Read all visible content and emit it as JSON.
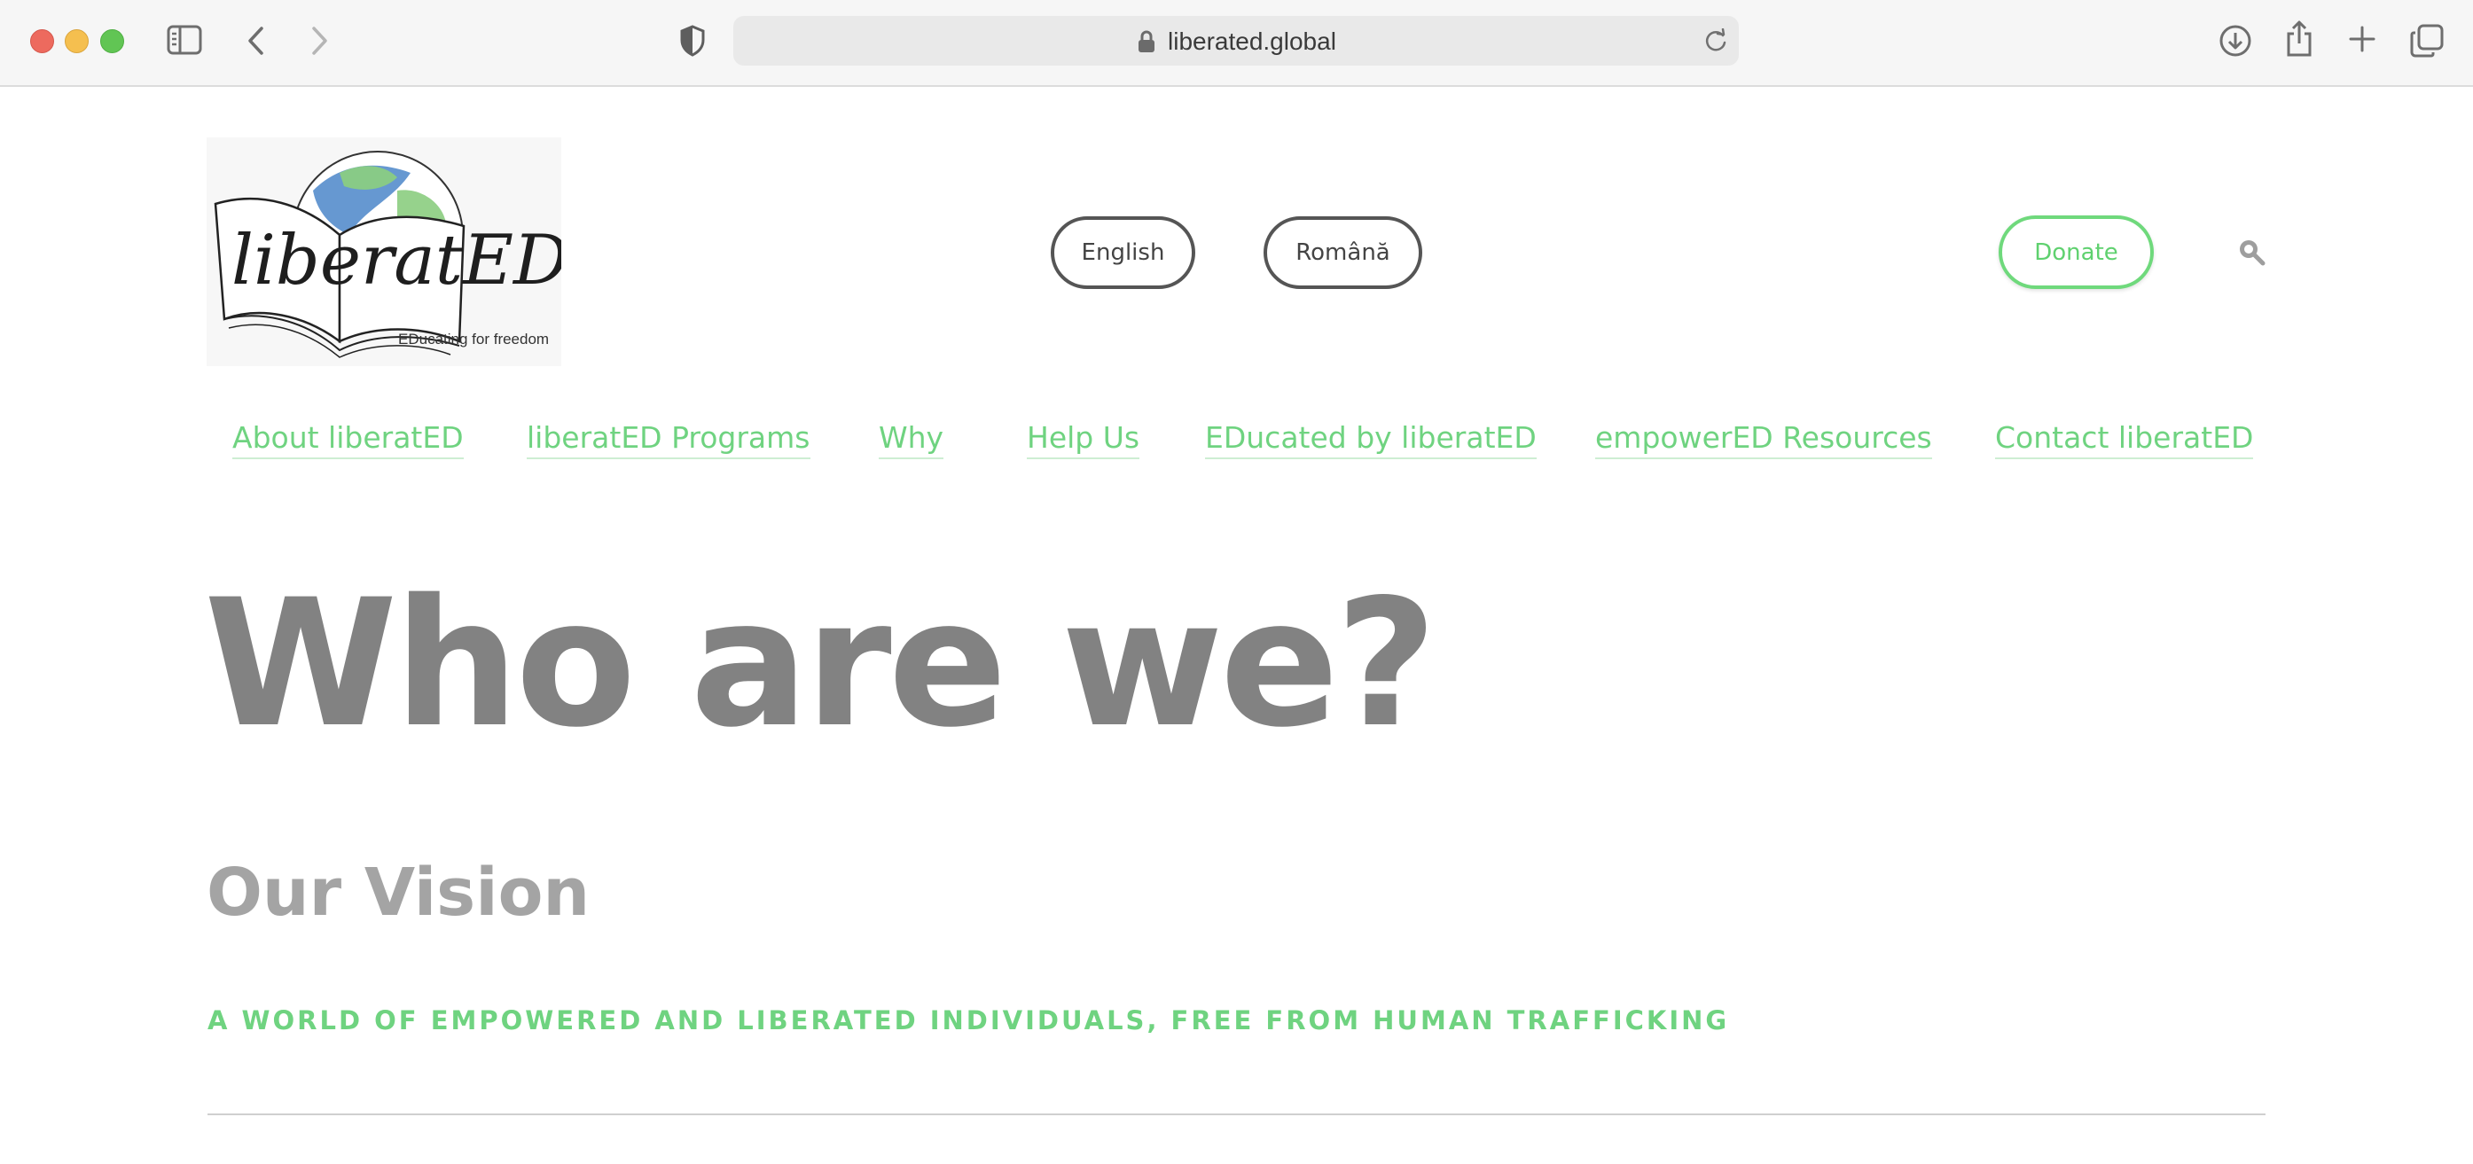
{
  "browser": {
    "url": "liberated.global",
    "icons": {
      "sidebar": "sidebar-icon",
      "back": "chevron-left-icon",
      "forward": "chevron-right-icon",
      "privacy": "shield-icon",
      "lock": "lock-icon",
      "reload": "reload-icon",
      "download": "download-icon",
      "share": "share-icon",
      "new_tab": "plus-icon",
      "tabs": "tabs-overview-icon"
    }
  },
  "header": {
    "logo": {
      "wordmark": "liberatED",
      "tagline": "EDucating for freedom"
    },
    "languages": [
      "English",
      "Română"
    ],
    "donate_label": "Donate",
    "search_icon": "search-icon"
  },
  "nav": {
    "items": [
      "About liberatED",
      "liberatED Programs",
      "Why",
      "Help Us",
      "EDucated by liberatED",
      "empowerED Resources",
      "Contact liberatED"
    ]
  },
  "main": {
    "hero_title": "Who are we?",
    "section_title": "Our Vision",
    "vision_statement": "A WORLD OF EMPOWERED AND LIBERATED INDIVIDUALS, FREE FROM HUMAN TRAFFICKING"
  },
  "colors": {
    "accent_green": "#6fd380",
    "hero_gray": "#828282",
    "subhead_gray": "#a4a4a4"
  }
}
